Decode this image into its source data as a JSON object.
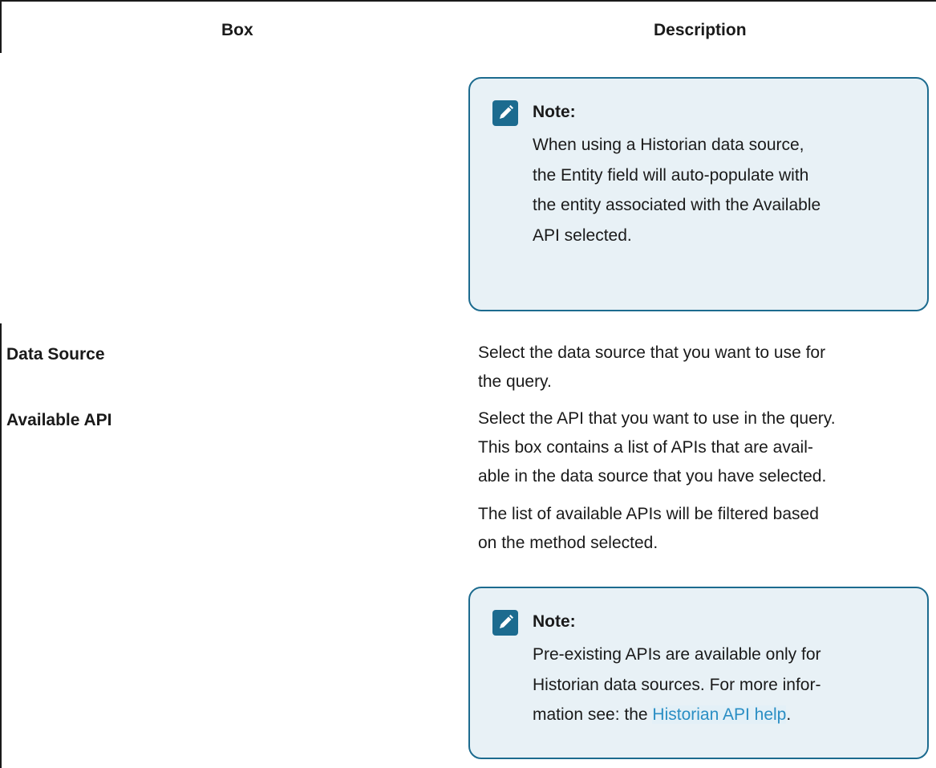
{
  "table": {
    "headers": {
      "box": "Box",
      "description": "Description"
    },
    "note1": {
      "title": "Note:",
      "lines": [
        "When using a Historian data source,",
        "the Entity field will auto-populate with",
        "the entity associated with the Available",
        "API selected."
      ]
    },
    "rows": [
      {
        "box": "Data Source",
        "description_lines": [
          "Select the data source that you want to use for",
          "the query."
        ]
      },
      {
        "box": "Available API",
        "description_lines": [
          "Select the API that you want to use in the query.",
          "This box contains a list of APIs that are avail-",
          "able in the data source that you have selected."
        ],
        "description2_lines": [
          "The list of available APIs will be filtered based",
          "on the method selected."
        ]
      }
    ],
    "note2": {
      "title": "Note:",
      "lines": [
        "Pre-existing APIs are available only for",
        "Historian data sources. For more infor-"
      ],
      "last_line_prefix": "mation see: the ",
      "link_text": "Historian API help",
      "last_line_suffix": "."
    }
  },
  "colors": {
    "note_border": "#1c6b8f",
    "note_background": "#e8f1f6",
    "link": "#2a8ec4"
  }
}
